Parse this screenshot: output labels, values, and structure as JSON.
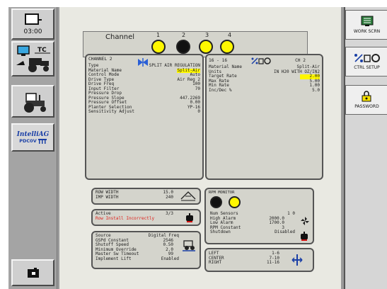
{
  "left_bar": {
    "time": "03:00",
    "intellag_line1": "IntelliAG",
    "intellag_line2": "PDC0V"
  },
  "right_bar": {
    "work_screen": "WORK SCRN",
    "ctrl_setup": "CTRL SETUP",
    "password": "PASSWORD"
  },
  "channel": {
    "label": "Channel",
    "numbers": [
      "1",
      "2",
      "3",
      "4"
    ],
    "left_panel": {
      "title": "CHANNEL 2",
      "rows": [
        {
          "k": "Type",
          "v": "SPLIT AIR REGULATION"
        },
        {
          "k": "Material Name",
          "v": "Split-Air"
        },
        {
          "k": "Control Mode",
          "v": "Auto"
        },
        {
          "k": "Drive Type",
          "v": "Air Reg 2"
        },
        {
          "k": "Drive Freq",
          "v": "100"
        },
        {
          "k": "Input Filter",
          "v": "70"
        },
        {
          "k": "Pressure Drop",
          "v": ""
        },
        {
          "k": "Pressure Slope",
          "v": "447.2269"
        },
        {
          "k": "Pressure Offset",
          "v": "0.00"
        },
        {
          "k": "Planter Selection",
          "v": "YP-16"
        },
        {
          "k": "Sensitivity Adjust",
          "v": "0"
        }
      ]
    },
    "right_panel": {
      "range": "16 - 16",
      "ch": "CH 2",
      "rows": [
        {
          "k": "Material Name",
          "v": "Split-Air"
        },
        {
          "k": "Units",
          "v": "IN H20 WITH OZ/IN2"
        },
        {
          "k": "Target Rate",
          "v": "2.00"
        },
        {
          "k": "Max Rate",
          "v": "5.00"
        },
        {
          "k": "Min Rate",
          "v": "1.00"
        },
        {
          "k": "Inc/Dec %",
          "v": "5.0"
        }
      ]
    }
  },
  "widths": {
    "rows": [
      {
        "k": "ROW WIDTH",
        "v": "15.0"
      },
      {
        "k": "IMP WIDTH",
        "v": "240"
      }
    ]
  },
  "active": {
    "label": "Active",
    "value": "3/3",
    "warning": "Row Install Incorrectly"
  },
  "source": {
    "rows": [
      {
        "k": "Source",
        "v": "Digital Freq"
      },
      {
        "k": "GSPd Constant",
        "v": "2546"
      },
      {
        "k": "Shutoff Speed",
        "v": "0.50"
      },
      {
        "k": "Minimum Override",
        "v": "2.0"
      },
      {
        "k": "Master Sw Timeout",
        "v": "99"
      },
      {
        "k": "Implement Lift",
        "v": "Enabled"
      }
    ]
  },
  "rpm": {
    "title": "RPM MONITOR",
    "rows": [
      {
        "k": "Num Sensors",
        "v": "1",
        "u": "0"
      },
      {
        "k": "High Alarm",
        "v": "2000.0"
      },
      {
        "k": "Low Alarm",
        "v": "1700.0"
      },
      {
        "k": "RPM Constant",
        "v": "3"
      },
      {
        "k": "Shutdown",
        "v": "Disabled"
      }
    ]
  },
  "sides": {
    "rows": [
      {
        "k": "LEFT",
        "v": "1-6"
      },
      {
        "k": "CENTER",
        "v": "7-10"
      },
      {
        "k": "RIGHT",
        "v": "11-16"
      }
    ]
  }
}
